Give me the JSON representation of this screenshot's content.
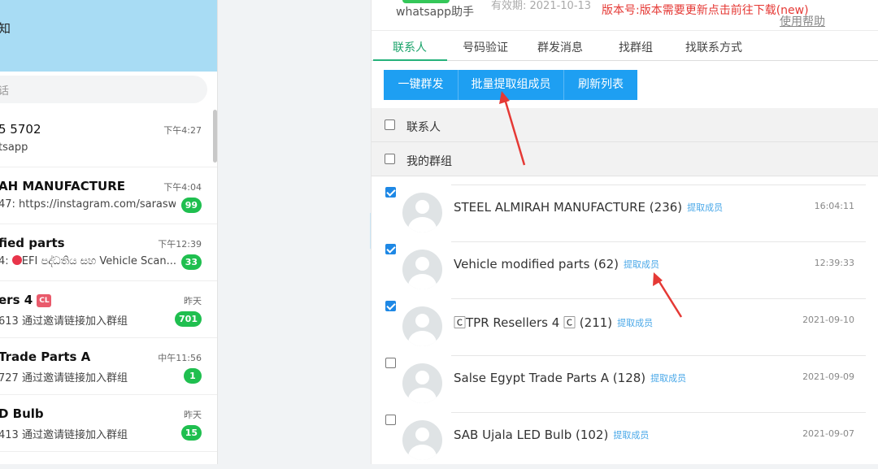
{
  "left_panel": {
    "header_name": "知",
    "search_placeholder": "话",
    "chats": [
      {
        "title": "5 5702",
        "subtitle": "tsapp",
        "time": "下午4:27",
        "badge": null,
        "bold": false
      },
      {
        "title": "AH MANUFACTURE",
        "subtitle": "47: https://instagram.com/sarasw...",
        "time": "下午4:04",
        "badge": "99",
        "bold": true
      },
      {
        "title": "fied parts",
        "subtitle_prefix": "4: ",
        "subtitle_rest": "EFI පද්ධතිය සහ Vehicle Scan...",
        "time": "下午12:39",
        "badge": "33",
        "bold": true
      },
      {
        "title": "ers 4",
        "subtitle": "613 通过邀请链接加入群组",
        "time": "昨天",
        "badge": "701",
        "bold": true
      },
      {
        "title": "Trade Parts A",
        "subtitle": "727 通过邀请链接加入群组",
        "time": "中午11:56",
        "badge": "1",
        "bold": true
      },
      {
        "title": "D Bulb",
        "subtitle": "413 通过邀请链接加入群组",
        "time": "昨天",
        "badge": "15",
        "bold": true
      }
    ]
  },
  "app": {
    "name": "whatsapp助手",
    "validity": "有效期: 2021-10-13",
    "version_notice": "版本号:版本需要更新点击前往下载(new)",
    "help_link": "使用帮助",
    "tabs": [
      "联系人",
      "号码验证",
      "群发消息",
      "找群组",
      "找联系方式"
    ],
    "active_tab": 0,
    "buttons": [
      "一键群发",
      "批量提取组成员",
      "刷新列表"
    ],
    "sections": [
      "联系人",
      "我的群组"
    ],
    "extract_label": "提取成员",
    "toggle_label": ">",
    "groups": [
      {
        "name": "STEEL ALMIRAH MANUFACTURE (236)",
        "time": "16:04:11",
        "checked": true
      },
      {
        "name": "Vehicle modified parts (62)",
        "time": "12:39:33",
        "checked": true
      },
      {
        "name": "🄲TPR Resellers 4 🄲 (211)",
        "time": "2021-09-10",
        "checked": true
      },
      {
        "name": "Salse Egypt Trade Parts A (128)",
        "time": "2021-09-09",
        "checked": false
      },
      {
        "name": "SAB Ujala LED Bulb (102)",
        "time": "2021-09-07",
        "checked": false
      }
    ],
    "cl_badge": "CL",
    "arrow_color": "#e53935"
  }
}
